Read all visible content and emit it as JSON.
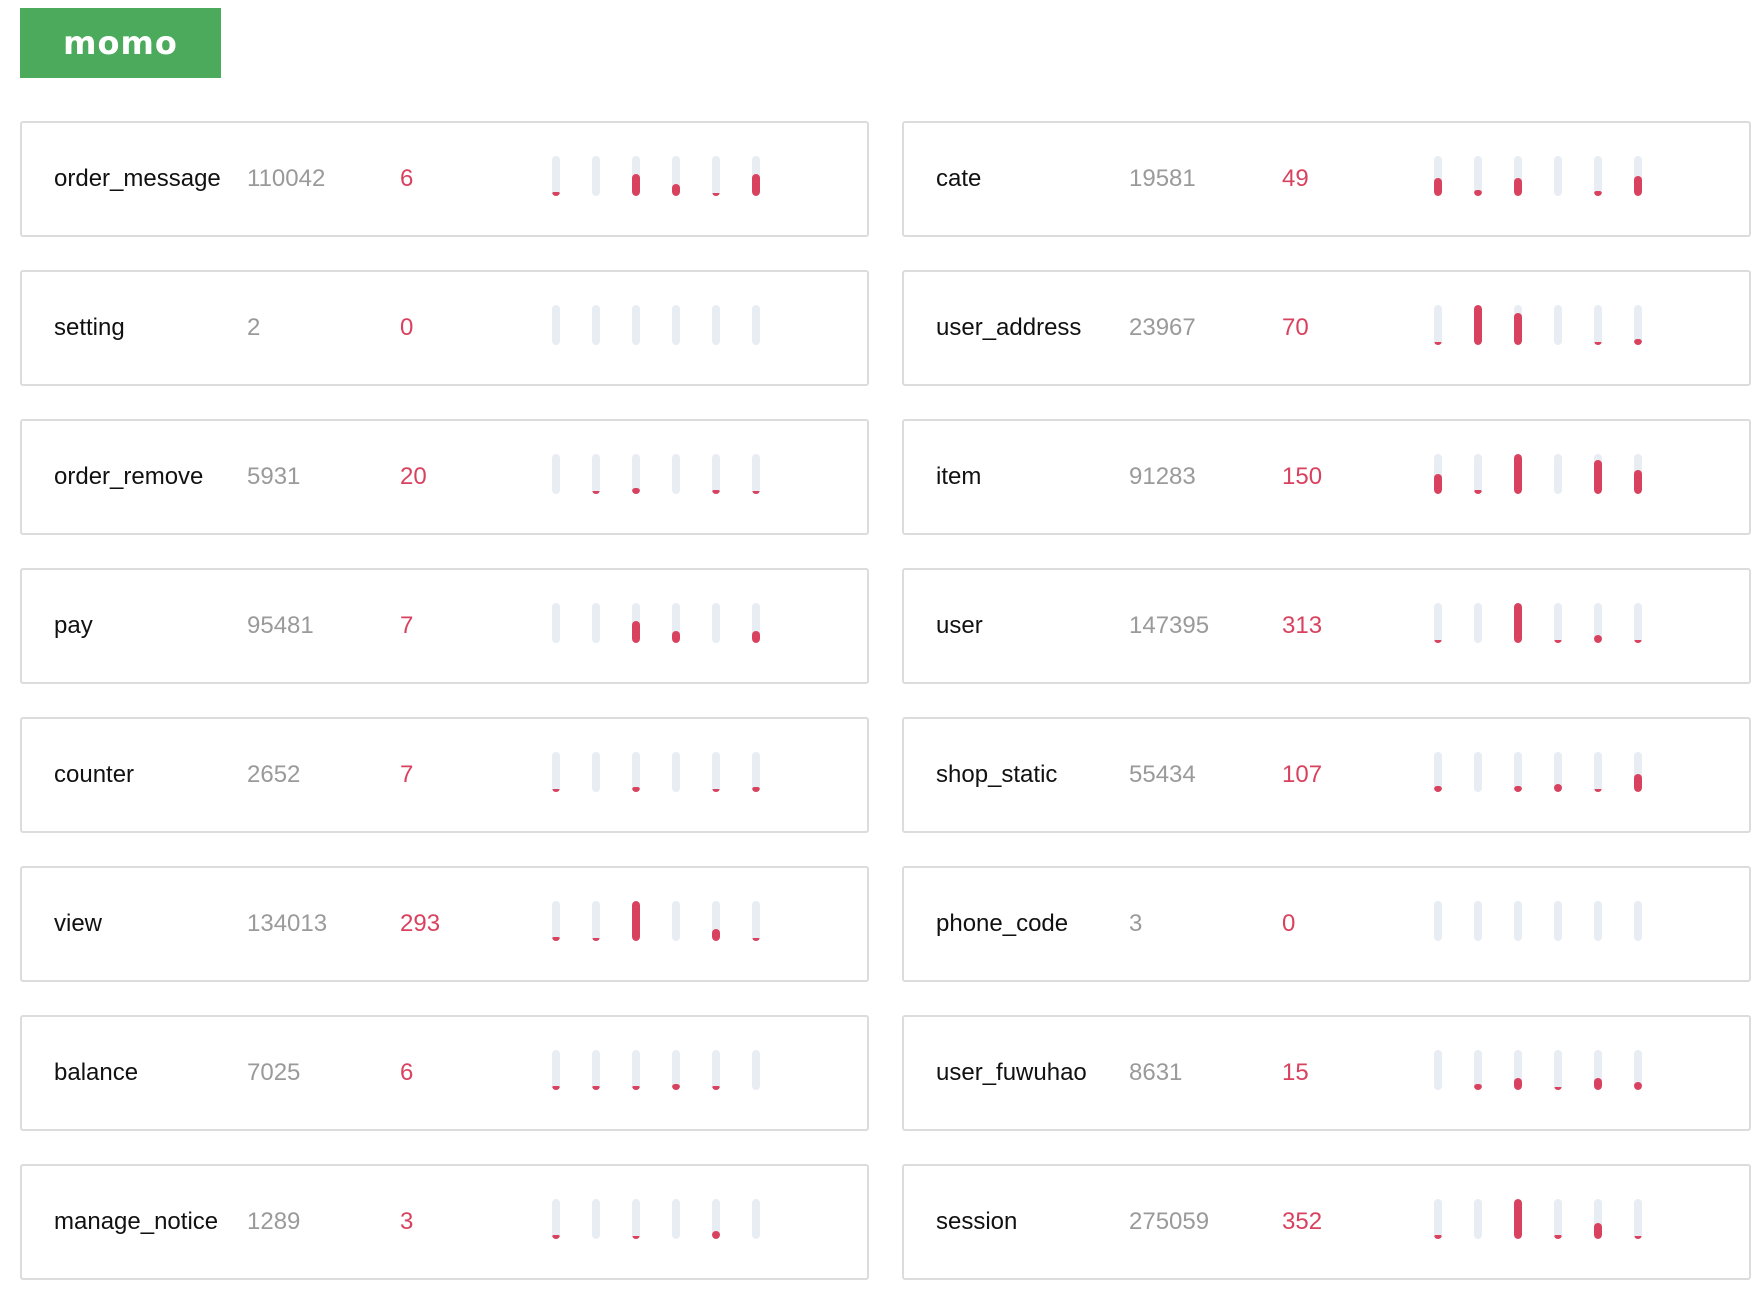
{
  "logo": {
    "text": "momo",
    "color": "#4caa5c"
  },
  "colors": {
    "accent": "#d9425f",
    "track": "#e8edf4",
    "muted": "#9a9a9a"
  },
  "cards": [
    {
      "name": "order_message",
      "total": "110042",
      "count": "6",
      "levels": [
        0.1,
        0,
        0.55,
        0.3,
        0.03,
        0.55
      ]
    },
    {
      "name": "cate",
      "total": "19581",
      "count": "49",
      "levels": [
        0.45,
        0.15,
        0.45,
        0,
        0.12,
        0.5
      ]
    },
    {
      "name": "setting",
      "total": "2",
      "count": "0",
      "levels": [
        0,
        0,
        0,
        0,
        0,
        0
      ]
    },
    {
      "name": "user_address",
      "total": "23967",
      "count": "70",
      "levels": [
        0.03,
        1.0,
        0.8,
        0,
        0.04,
        0.15
      ]
    },
    {
      "name": "order_remove",
      "total": "5931",
      "count": "20",
      "levels": [
        0,
        0.05,
        0.15,
        0,
        0.1,
        0.05
      ]
    },
    {
      "name": "item",
      "total": "91283",
      "count": "150",
      "levels": [
        0.5,
        0.1,
        1.0,
        0,
        0.85,
        0.6
      ]
    },
    {
      "name": "pay",
      "total": "95481",
      "count": "7",
      "levels": [
        0,
        0,
        0.55,
        0.3,
        0,
        0.3
      ]
    },
    {
      "name": "user",
      "total": "147395",
      "count": "313",
      "levels": [
        0.04,
        0,
        1.0,
        0.04,
        0.2,
        0.04
      ]
    },
    {
      "name": "counter",
      "total": "2652",
      "count": "7",
      "levels": [
        0.04,
        0,
        0.12,
        0,
        0.08,
        0.12
      ]
    },
    {
      "name": "shop_static",
      "total": "55434",
      "count": "107",
      "levels": [
        0.15,
        0,
        0.15,
        0.2,
        0.04,
        0.45
      ]
    },
    {
      "name": "view",
      "total": "134013",
      "count": "293",
      "levels": [
        0.1,
        0.04,
        1.0,
        0,
        0.3,
        0.04
      ]
    },
    {
      "name": "phone_code",
      "total": "3",
      "count": "0",
      "levels": [
        0,
        0,
        0,
        0,
        0,
        0
      ]
    },
    {
      "name": "balance",
      "total": "7025",
      "count": "6",
      "levels": [
        0.1,
        0.1,
        0.1,
        0.15,
        0.1,
        0
      ]
    },
    {
      "name": "user_fuwuhao",
      "total": "8631",
      "count": "15",
      "levels": [
        0,
        0.15,
        0.3,
        0.04,
        0.3,
        0.2
      ]
    },
    {
      "name": "manage_notice",
      "total": "1289",
      "count": "3",
      "levels": [
        0.1,
        0,
        0.04,
        0,
        0.2,
        0
      ]
    },
    {
      "name": "session",
      "total": "275059",
      "count": "352",
      "levels": [
        0.1,
        0,
        1.0,
        0.1,
        0.4,
        0.04
      ]
    }
  ]
}
